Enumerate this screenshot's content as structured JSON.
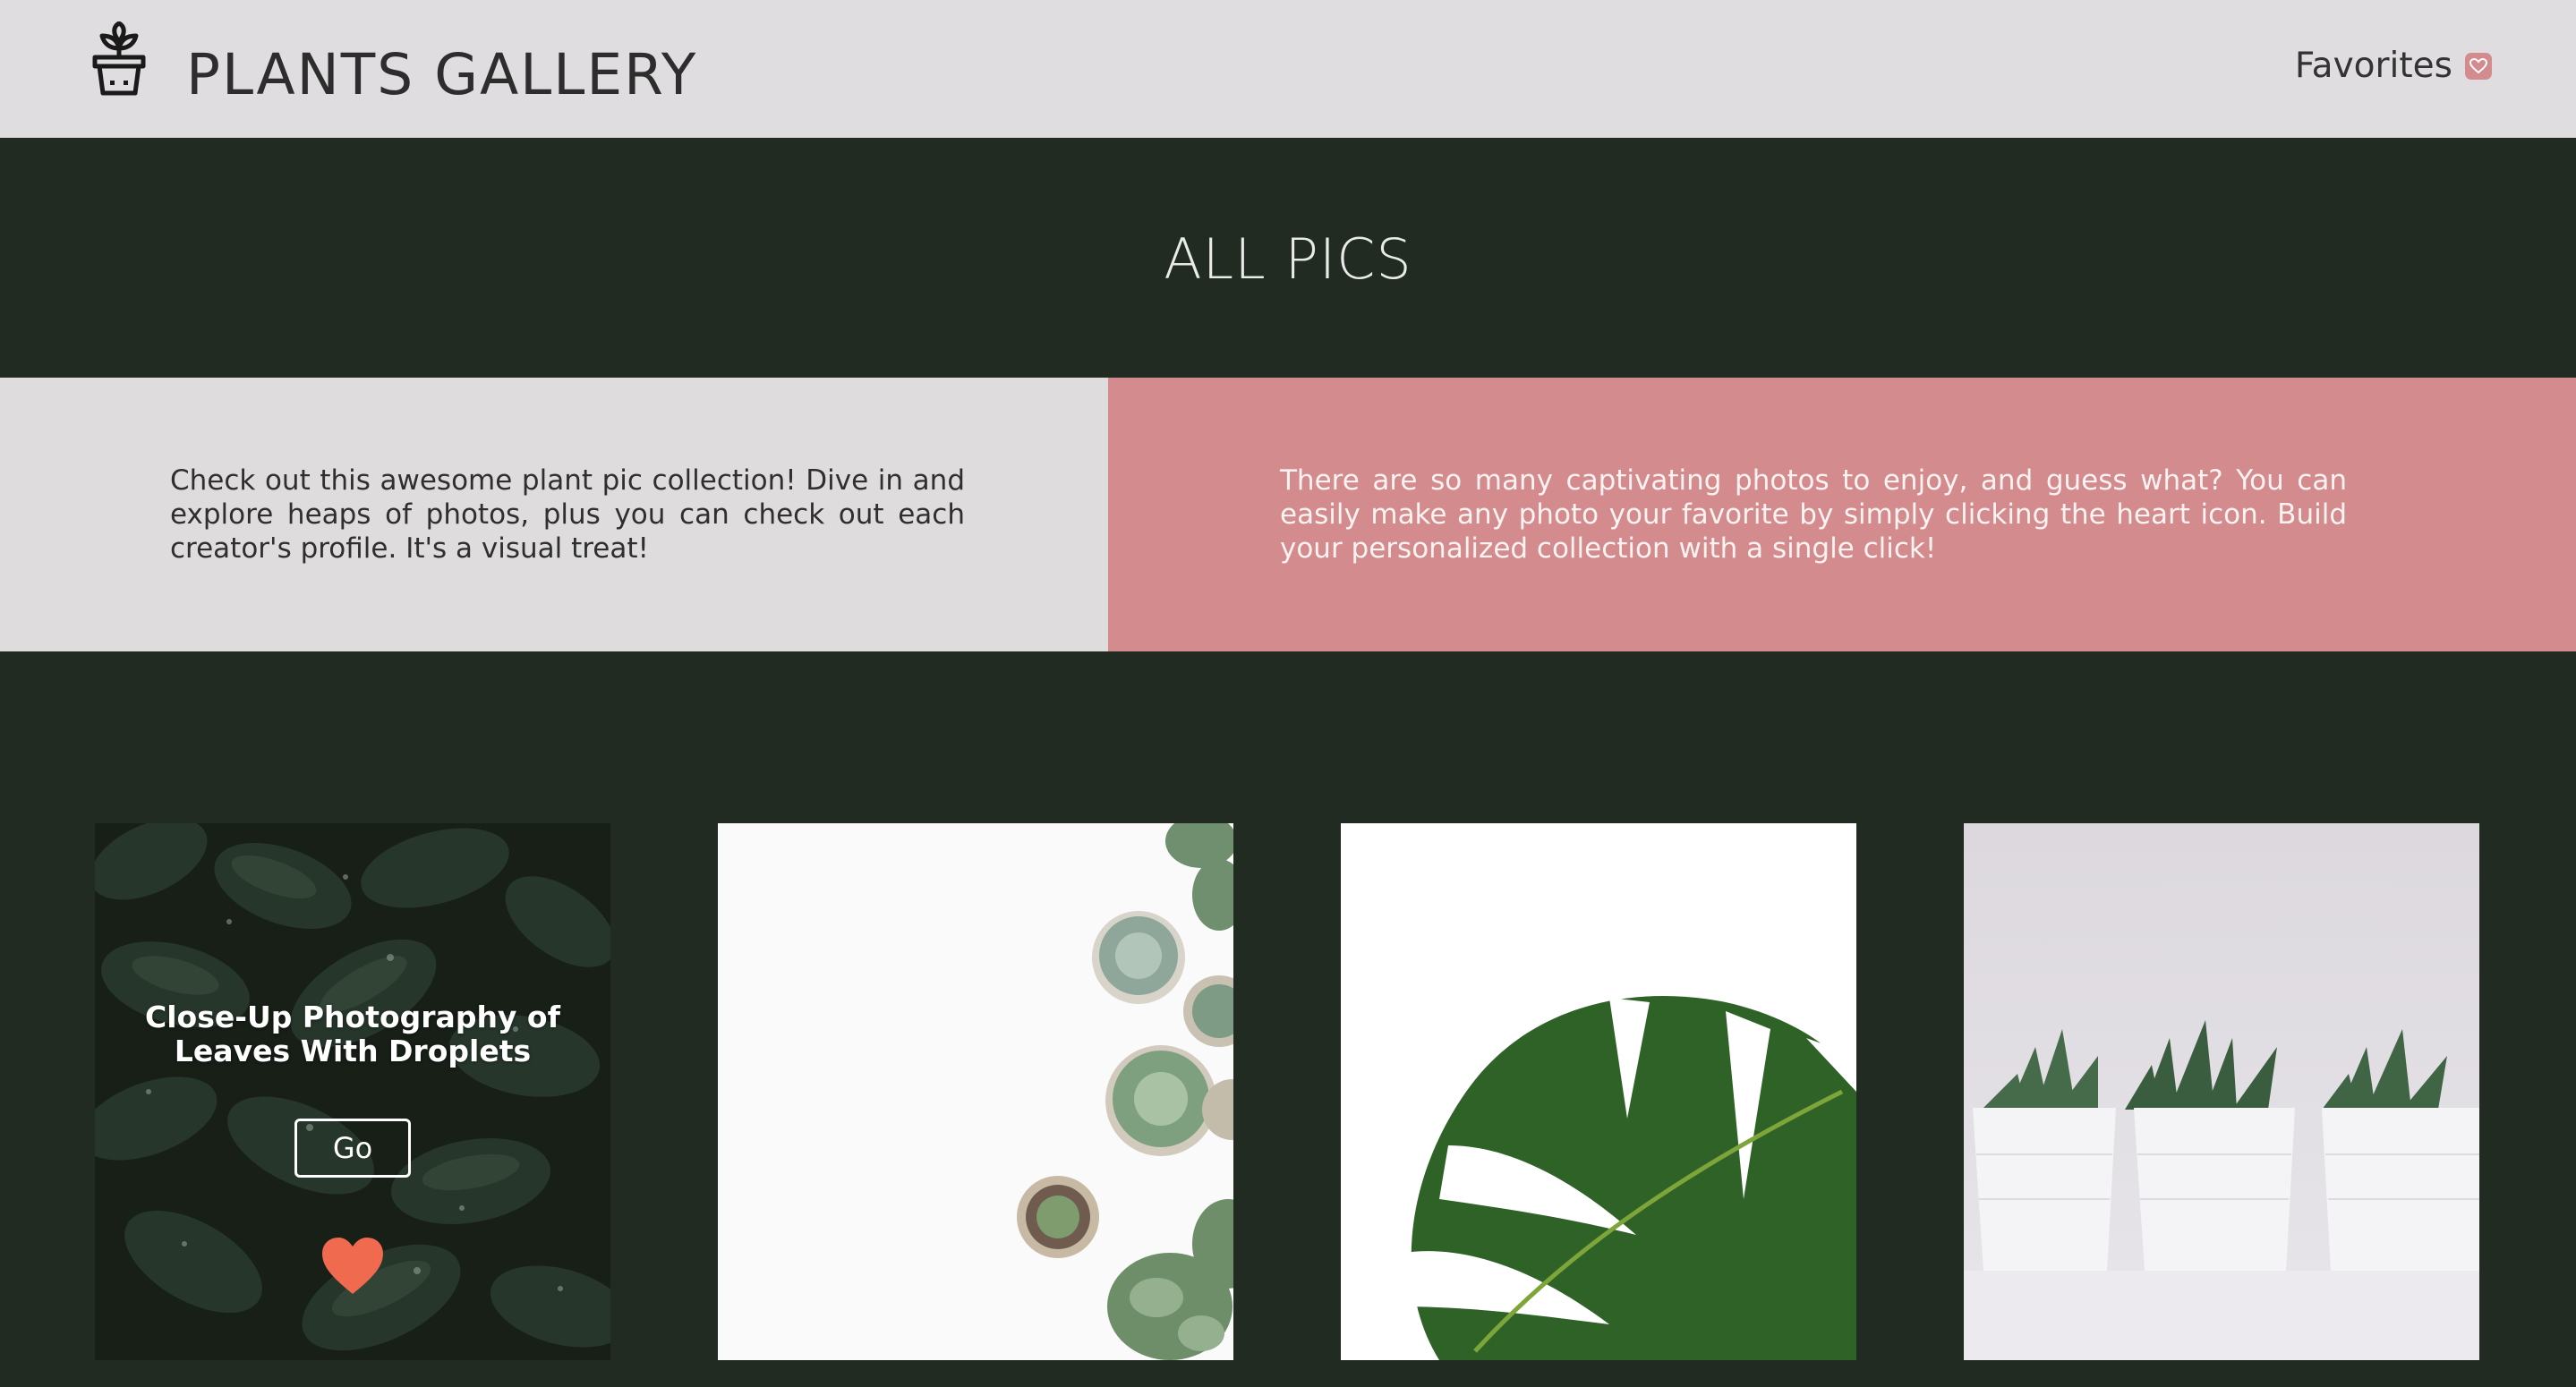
{
  "header": {
    "title": "PLANTS GALLERY",
    "favorites_label": "Favorites",
    "logo_icon": "potted-plant-icon",
    "favorites_icon": "heart-icon"
  },
  "hero": {
    "title": "ALL PICS"
  },
  "info": {
    "left_text": "Check out this awesome plant pic collection! Dive in and explore heaps of photos, plus you can check out each creator's profile. It's a visual treat!",
    "right_text": "There are so many captivating photos to enjoy, and guess what? You can easily make any photo your favorite by simply clicking the heart icon. Build your personalized collection with a single click!"
  },
  "gallery": {
    "cards": [
      {
        "caption": "Close-Up Photography of Leaves With Droplets",
        "go_label": "Go",
        "favorite_icon": "heart-icon"
      },
      {},
      {},
      {}
    ]
  },
  "colors": {
    "header_bg": "#dfdddf",
    "page_bg": "#212b21",
    "accent_pink": "#d38b8d",
    "heart": "#ef6a4e"
  }
}
